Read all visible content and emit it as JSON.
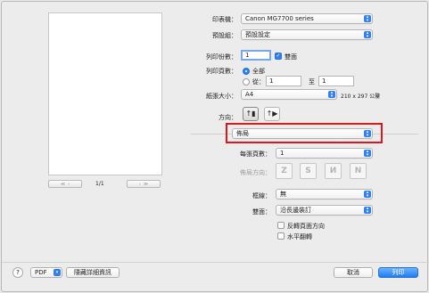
{
  "printer": {
    "label": "印表機：",
    "value": "Canon MG7700 series"
  },
  "presets": {
    "label": "預設組：",
    "value": "預設設定"
  },
  "copies": {
    "label": "列印份數：",
    "value": "1",
    "duplex_label": "雙面",
    "duplex_checked": true
  },
  "pages": {
    "label": "列印頁數：",
    "all_label": "全部",
    "from_label": "從：",
    "from_value": "1",
    "to_label": "至",
    "to_value": "1"
  },
  "paper_size": {
    "label": "紙張大小：",
    "value": "A4",
    "dimensions": "210 x 297 公釐"
  },
  "orientation": {
    "label": "方向："
  },
  "preview": {
    "page_indicator": "1/1"
  },
  "section": {
    "value": "佈局"
  },
  "layout": {
    "pages_per_sheet_label": "每張頁數：",
    "pages_per_sheet_value": "1",
    "direction_label": "佈局方向：",
    "border_label": "框線：",
    "border_value": "無",
    "two_sided_label": "雙面：",
    "two_sided_value": "沿長邊裝訂",
    "reverse_label": "反轉頁面方向",
    "flip_label": "水平翻轉"
  },
  "footer": {
    "help": "?",
    "pdf": "PDF",
    "hide_details": "隱藏詳細資訊",
    "cancel": "取消",
    "print": "列印"
  },
  "colors": {
    "accent": "#2f7ff5",
    "highlight": "#e0161b"
  }
}
